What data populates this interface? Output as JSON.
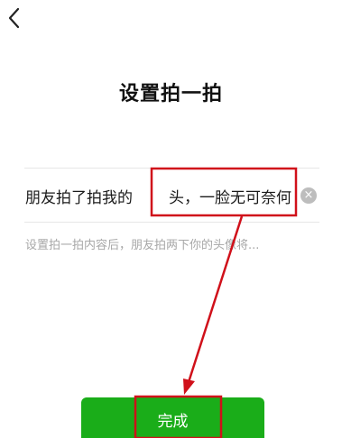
{
  "header": {
    "back_icon": "chevron-left-icon"
  },
  "page": {
    "title": "设置拍一拍"
  },
  "pat_setting": {
    "prefix": "朋友拍了拍我的",
    "value": "头，一脸无可奈何",
    "clear_icon": "clear-circle-icon",
    "hint": "设置拍一拍内容后，朋友拍两下你的头像将..."
  },
  "footer": {
    "done_label": "完成"
  },
  "colors": {
    "accent": "#1aad19",
    "annotation": "#d0101a"
  }
}
